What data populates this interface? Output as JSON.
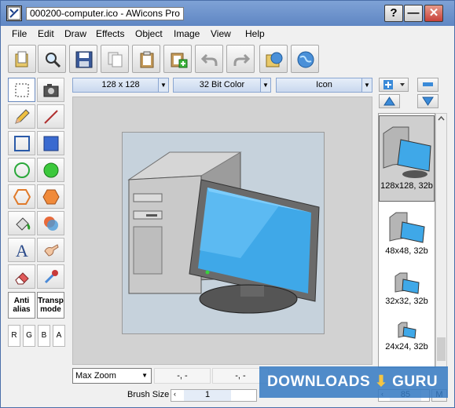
{
  "window": {
    "title": "000200-computer.ico - AWicons Pro"
  },
  "title_buttons": {
    "help": "?",
    "minimize": "—",
    "close": "✕"
  },
  "menu": [
    "File",
    "Edit",
    "Draw",
    "Effects",
    "Object",
    "Image",
    "View",
    "Help"
  ],
  "text_tools": {
    "antialias": "Anti alias",
    "transp": "Transp mode"
  },
  "channels": [
    "R",
    "G",
    "B",
    "A"
  ],
  "options": {
    "size": "128 x 128",
    "depth": "32 Bit Color",
    "type": "Icon"
  },
  "formats": [
    "128x128, 32b",
    "48x48, 32b",
    "32x32, 32b",
    "24x24, 32b"
  ],
  "status": {
    "zoom": "Max Zoom",
    "coord1": "-, -",
    "coord2": "-, -",
    "brush_label": "Brush Size",
    "brush_value": "1",
    "value2": "85",
    "m_label": "M"
  },
  "watermark": {
    "text_main": "DOWNLOADS",
    "text_guru": "GURU"
  },
  "colors": {
    "titlebar": "#6a8fc7",
    "accent": "#4a6ea9",
    "monitor_screen": "#3fa8e8"
  }
}
